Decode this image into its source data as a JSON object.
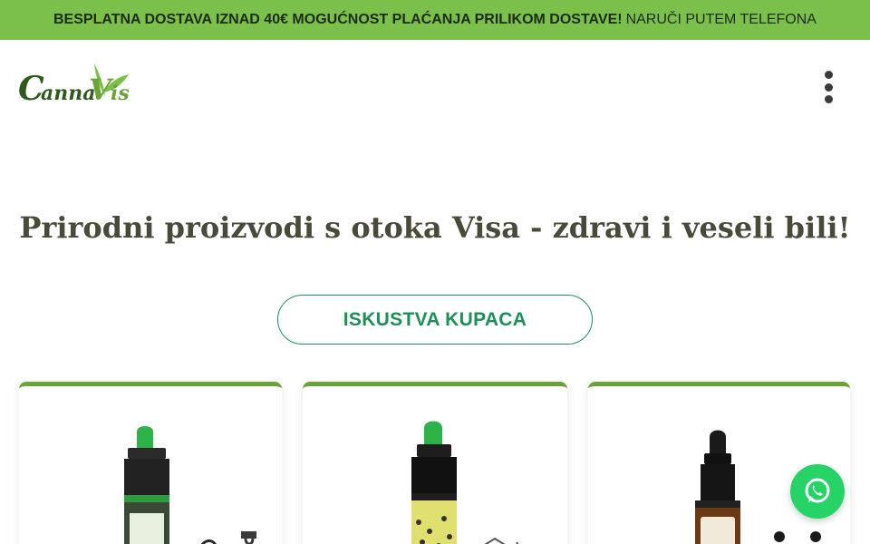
{
  "announcement": {
    "bold_text": "BESPLATNA DOSTAVA IZNAD 40€ MOGUĆNOST PLAĆANJA PRILIKOM DOSTAVE!",
    "normal_text": "NARUČI PUTEM TELEFONA",
    "background_color": "#7bc04a"
  },
  "header": {
    "logo_text": "CannaVis",
    "menu_icon": "vertical-dots-icon"
  },
  "hero": {
    "headline": "Prirodni proizvodi s otoka Visa - zdravi i veseli bili!",
    "cta_label": "ISKUSTVA KUPACA",
    "accent_color": "#1f8f5a"
  },
  "products": [
    {
      "image": "green-dropper-bottle-image"
    },
    {
      "image": "green-dropper-bottle-yellow-label-image"
    },
    {
      "image": "black-dropper-bottle-amber-image"
    }
  ],
  "whatsapp": {
    "icon": "whatsapp-icon",
    "color": "#25d366"
  }
}
